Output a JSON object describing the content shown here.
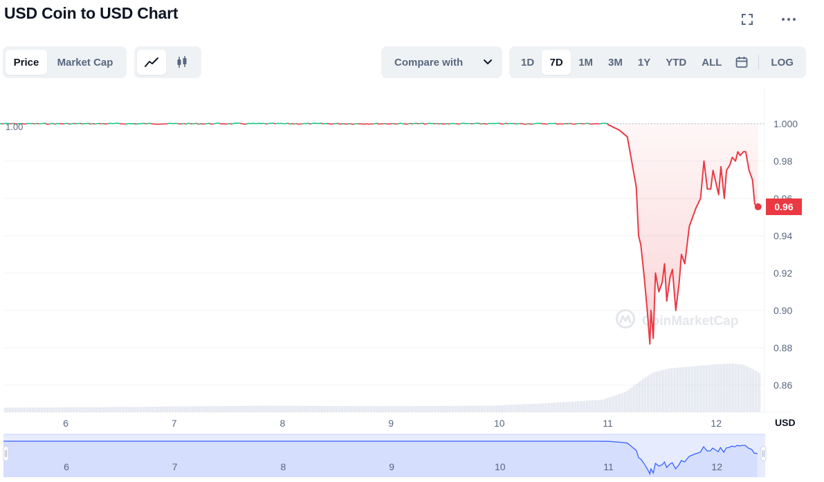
{
  "header": {
    "title": "USD Coin to USD Chart"
  },
  "toolbar": {
    "metric_tabs": [
      {
        "label": "Price",
        "active": true
      },
      {
        "label": "Market Cap",
        "active": false
      }
    ],
    "chart_types": [
      {
        "icon": "line-chart-icon",
        "active": true
      },
      {
        "icon": "candlestick-icon",
        "active": false
      }
    ],
    "compare_label": "Compare with",
    "ranges": [
      {
        "label": "1D",
        "active": false
      },
      {
        "label": "7D",
        "active": true
      },
      {
        "label": "1M",
        "active": false
      },
      {
        "label": "3M",
        "active": false
      },
      {
        "label": "1Y",
        "active": false
      },
      {
        "label": "YTD",
        "active": false
      },
      {
        "label": "ALL",
        "active": false
      }
    ],
    "log_label": "LOG"
  },
  "colors": {
    "down": "#ea3943",
    "up": "#16c784",
    "navigator": "#3861fb",
    "volume": "#cfd6e4",
    "axis_text": "#58667e"
  },
  "watermark": "CoinMarketCap",
  "chart_data": {
    "type": "line",
    "x_unit": "day",
    "xlim": [
      5.65,
      12.4
    ],
    "ylim": [
      0.854,
      1.008
    ],
    "y_ticks": [
      "1.000",
      "0.98",
      "0.96",
      "0.94",
      "0.92",
      "0.90",
      "0.88",
      "0.86"
    ],
    "y_tick_values": [
      1.0,
      0.98,
      0.96,
      0.94,
      0.92,
      0.9,
      0.88,
      0.86
    ],
    "x_ticks": [
      "6",
      "7",
      "8",
      "9",
      "10",
      "11",
      "12"
    ],
    "x_tick_values": [
      6,
      7,
      8,
      9,
      10,
      11,
      12
    ],
    "y_unit_label": "USD",
    "open_label": "1.00",
    "open_value": 1.0,
    "current_label": "0.96",
    "current_value": 0.9555,
    "series": [
      {
        "x": [
          5.65,
          6.0,
          6.5,
          7.0,
          7.5,
          8.0,
          8.5,
          9.0,
          9.5,
          10.0,
          10.5,
          10.9,
          11.05,
          11.15,
          11.22,
          11.3,
          11.32,
          11.34,
          11.37,
          11.4,
          11.42,
          11.43,
          11.44,
          11.45,
          11.47,
          11.5,
          11.53,
          11.55,
          11.57,
          11.6,
          11.62,
          11.65,
          11.68,
          11.7,
          11.73,
          11.77,
          11.8,
          11.83,
          11.87,
          11.9,
          11.93,
          11.96,
          11.98,
          12.0,
          12.03,
          12.05,
          12.08,
          12.1,
          12.13,
          12.15,
          12.18,
          12.2,
          12.22,
          12.25,
          12.27,
          12.3,
          12.33,
          12.35,
          12.38
        ],
        "values": [
          1.0,
          1.0,
          1.0,
          1.0,
          1.0,
          1.0,
          1.0,
          1.0,
          1.0,
          1.0,
          1.0,
          1.0,
          0.9995,
          0.9965,
          0.993,
          0.966,
          0.94,
          0.935,
          0.918,
          0.898,
          0.882,
          0.9,
          0.893,
          0.885,
          0.92,
          0.91,
          0.915,
          0.925,
          0.905,
          0.918,
          0.922,
          0.9,
          0.915,
          0.93,
          0.925,
          0.945,
          0.95,
          0.955,
          0.96,
          0.98,
          0.965,
          0.965,
          0.975,
          0.97,
          0.962,
          0.977,
          0.96,
          0.975,
          0.978,
          0.982,
          0.98,
          0.985,
          0.983,
          0.985,
          0.985,
          0.975,
          0.97,
          0.957,
          0.9555
        ]
      }
    ],
    "volume": {
      "x": [
        5.65,
        6.5,
        7.5,
        8.0,
        9.0,
        10.0,
        10.5,
        11.0,
        11.2,
        11.35,
        11.45,
        11.6,
        11.8,
        12.0,
        12.15,
        12.25,
        12.35,
        12.4
      ],
      "values": [
        0.09,
        0.1,
        0.12,
        0.13,
        0.12,
        0.13,
        0.18,
        0.25,
        0.4,
        0.65,
        0.8,
        0.88,
        0.92,
        0.96,
        0.98,
        0.95,
        0.85,
        0.78
      ]
    },
    "navigator": {
      "x_ticks": [
        "6",
        "7",
        "8",
        "9",
        "10",
        "11",
        "12"
      ]
    }
  }
}
